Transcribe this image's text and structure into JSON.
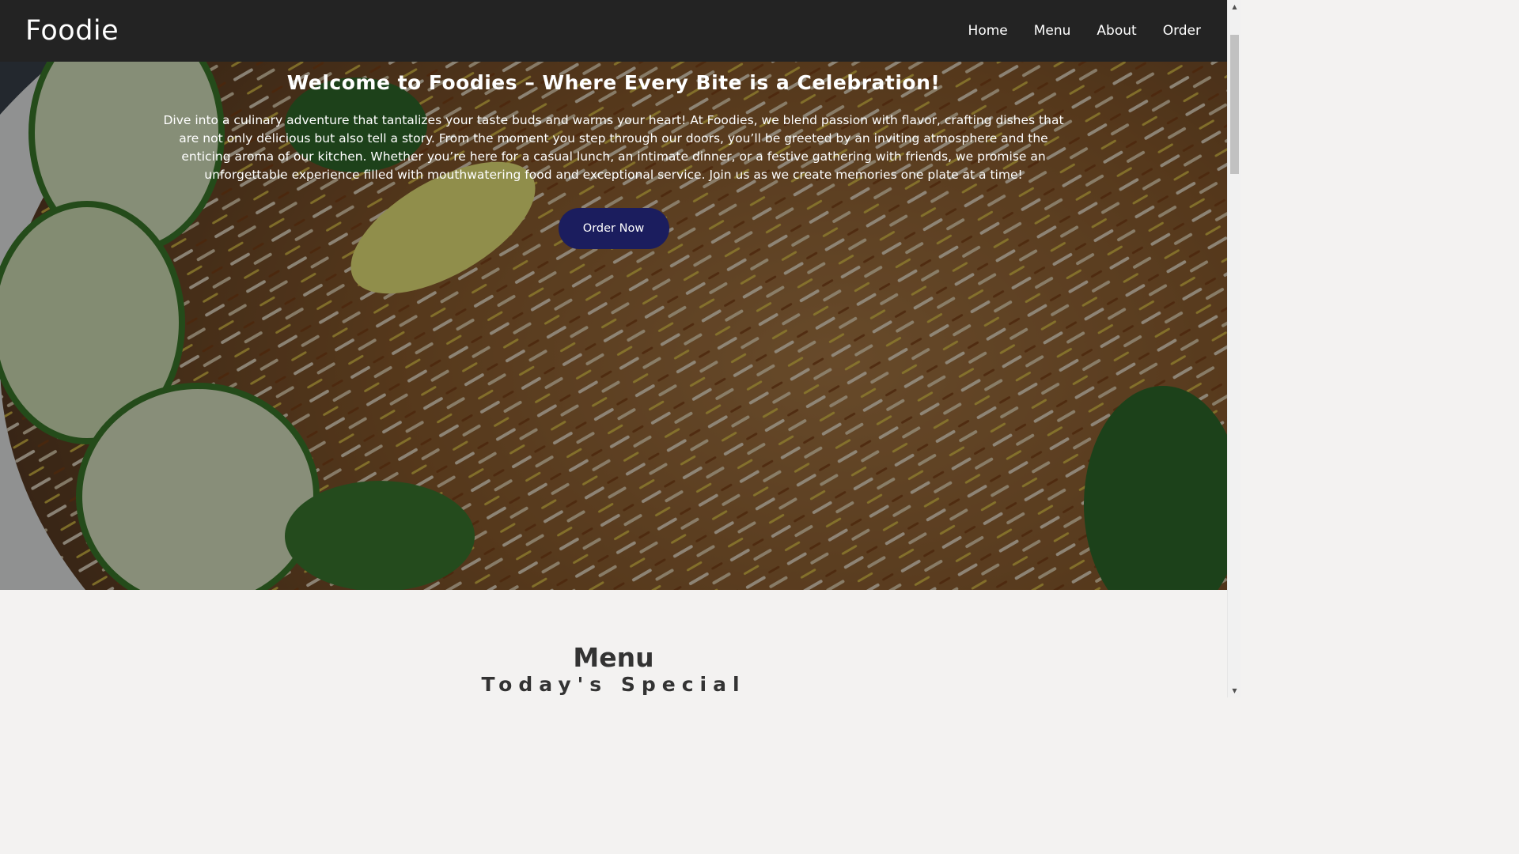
{
  "navbar": {
    "brand": "Foodie",
    "links": [
      "Home",
      "Menu",
      "About",
      "Order"
    ]
  },
  "hero": {
    "title": "Welcome to Foodies – Where Every Bite is a Celebration!",
    "text": "Dive into a culinary adventure that tantalizes your taste buds and warms your heart! At Foodies, we blend passion with flavor, crafting dishes that are not only delicious but also tell a story. From the moment you step through our doors, you’ll be greeted by an inviting atmosphere and the enticing aroma of our kitchen. Whether you’re here for a casual lunch, an intimate dinner, or a festive gathering with friends, we promise an unforgettable experience filled with mouthwatering food and exceptional service. Join us as we create memories one plate at a time!",
    "button_label": "Order Now",
    "button_color": "#1b1d5e"
  },
  "menu_section": {
    "title": "Menu",
    "subtitle": "Today's Special"
  },
  "colors": {
    "navbar_bg": "#232323",
    "page_bg": "#f3f2f1"
  },
  "scrollbar": {
    "up_icon": "triangle-up-icon",
    "down_icon": "triangle-down-icon"
  }
}
